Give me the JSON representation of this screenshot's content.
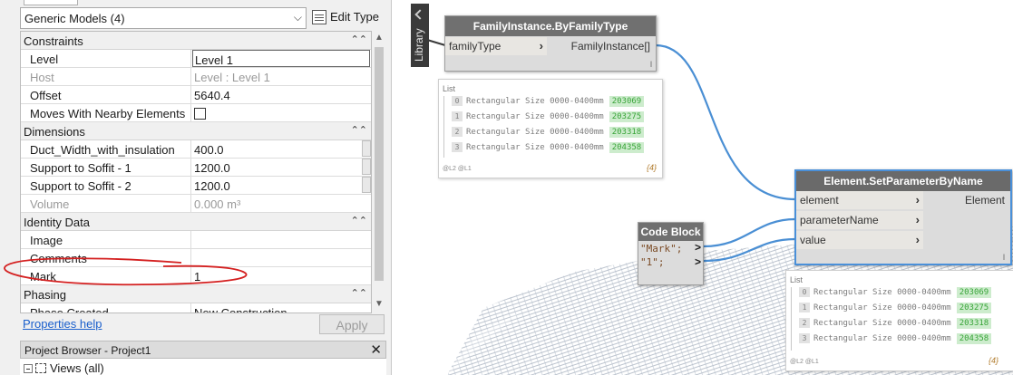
{
  "properties": {
    "type_selector": "Generic Models (4)",
    "edit_type_label": "Edit Type",
    "sections": {
      "constraints": "Constraints",
      "dimensions": "Dimensions",
      "identity": "Identity Data",
      "phasing": "Phasing"
    },
    "rows": {
      "level": {
        "key": "Level",
        "value": "Level 1"
      },
      "host": {
        "key": "Host",
        "value": "Level : Level 1"
      },
      "offset": {
        "key": "Offset",
        "value": "5640.4"
      },
      "moves": {
        "key": "Moves With Nearby Elements",
        "value": ""
      },
      "duct_width": {
        "key": "Duct_Width_with_insulation",
        "value": "400.0"
      },
      "soffit1": {
        "key": "Support to Soffit - 1",
        "value": "1200.0"
      },
      "soffit2": {
        "key": "Support to Soffit - 2",
        "value": "1200.0"
      },
      "volume": {
        "key": "Volume",
        "value": "0.000 m³"
      },
      "image": {
        "key": "Image",
        "value": ""
      },
      "comments": {
        "key": "Comments",
        "value": ""
      },
      "mark": {
        "key": "Mark",
        "value": "1"
      },
      "phase_created": {
        "key": "Phase Created",
        "value": "New Construction"
      }
    },
    "help_link": "Properties help",
    "apply_label": "Apply"
  },
  "project_browser": {
    "title": "Project Browser - Project1",
    "close_glyph": "✕",
    "views_label": "Views (all)"
  },
  "dynamo": {
    "library_label": "Library",
    "node_family_instance": {
      "title": "FamilyInstance.ByFamilyType",
      "input": "familyType",
      "output": "FamilyInstance[]",
      "lacing": "l"
    },
    "node_set_param": {
      "title": "Element.SetParameterByName",
      "inputs": [
        "element",
        "parameterName",
        "value"
      ],
      "output": "Element",
      "lacing": "l"
    },
    "node_code_block": {
      "title": "Code Block",
      "lines": [
        "\"Mark\";",
        "\"1\";"
      ]
    },
    "preview_top": {
      "header": "List",
      "items": [
        {
          "idx": "0",
          "text": "Rectangular Size 0000-0400mm",
          "value": "203069"
        },
        {
          "idx": "1",
          "text": "Rectangular Size 0000-0400mm",
          "value": "203275"
        },
        {
          "idx": "2",
          "text": "Rectangular Size 0000-0400mm",
          "value": "203318"
        },
        {
          "idx": "3",
          "text": "Rectangular Size 0000-0400mm",
          "value": "204358"
        }
      ],
      "footer": "@L2 @L1",
      "count": "{4}"
    },
    "preview_bottom": {
      "header": "List",
      "items": [
        {
          "idx": "0",
          "text": "Rectangular Size 0000-0400mm",
          "value": "203069"
        },
        {
          "idx": "1",
          "text": "Rectangular Size 0000-0400mm",
          "value": "203275"
        },
        {
          "idx": "2",
          "text": "Rectangular Size 0000-0400mm",
          "value": "203318"
        },
        {
          "idx": "3",
          "text": "Rectangular Size 0000-0400mm",
          "value": "204358"
        }
      ],
      "footer": "@L2 @L1",
      "count": "{4}"
    }
  },
  "colors": {
    "wire": "#4a8fd4",
    "annotation": "#d42020",
    "node_header": "#707070",
    "selection": "#4a90d9",
    "preview_value_bg": "#cdeccd",
    "preview_value_text": "#38a438"
  }
}
